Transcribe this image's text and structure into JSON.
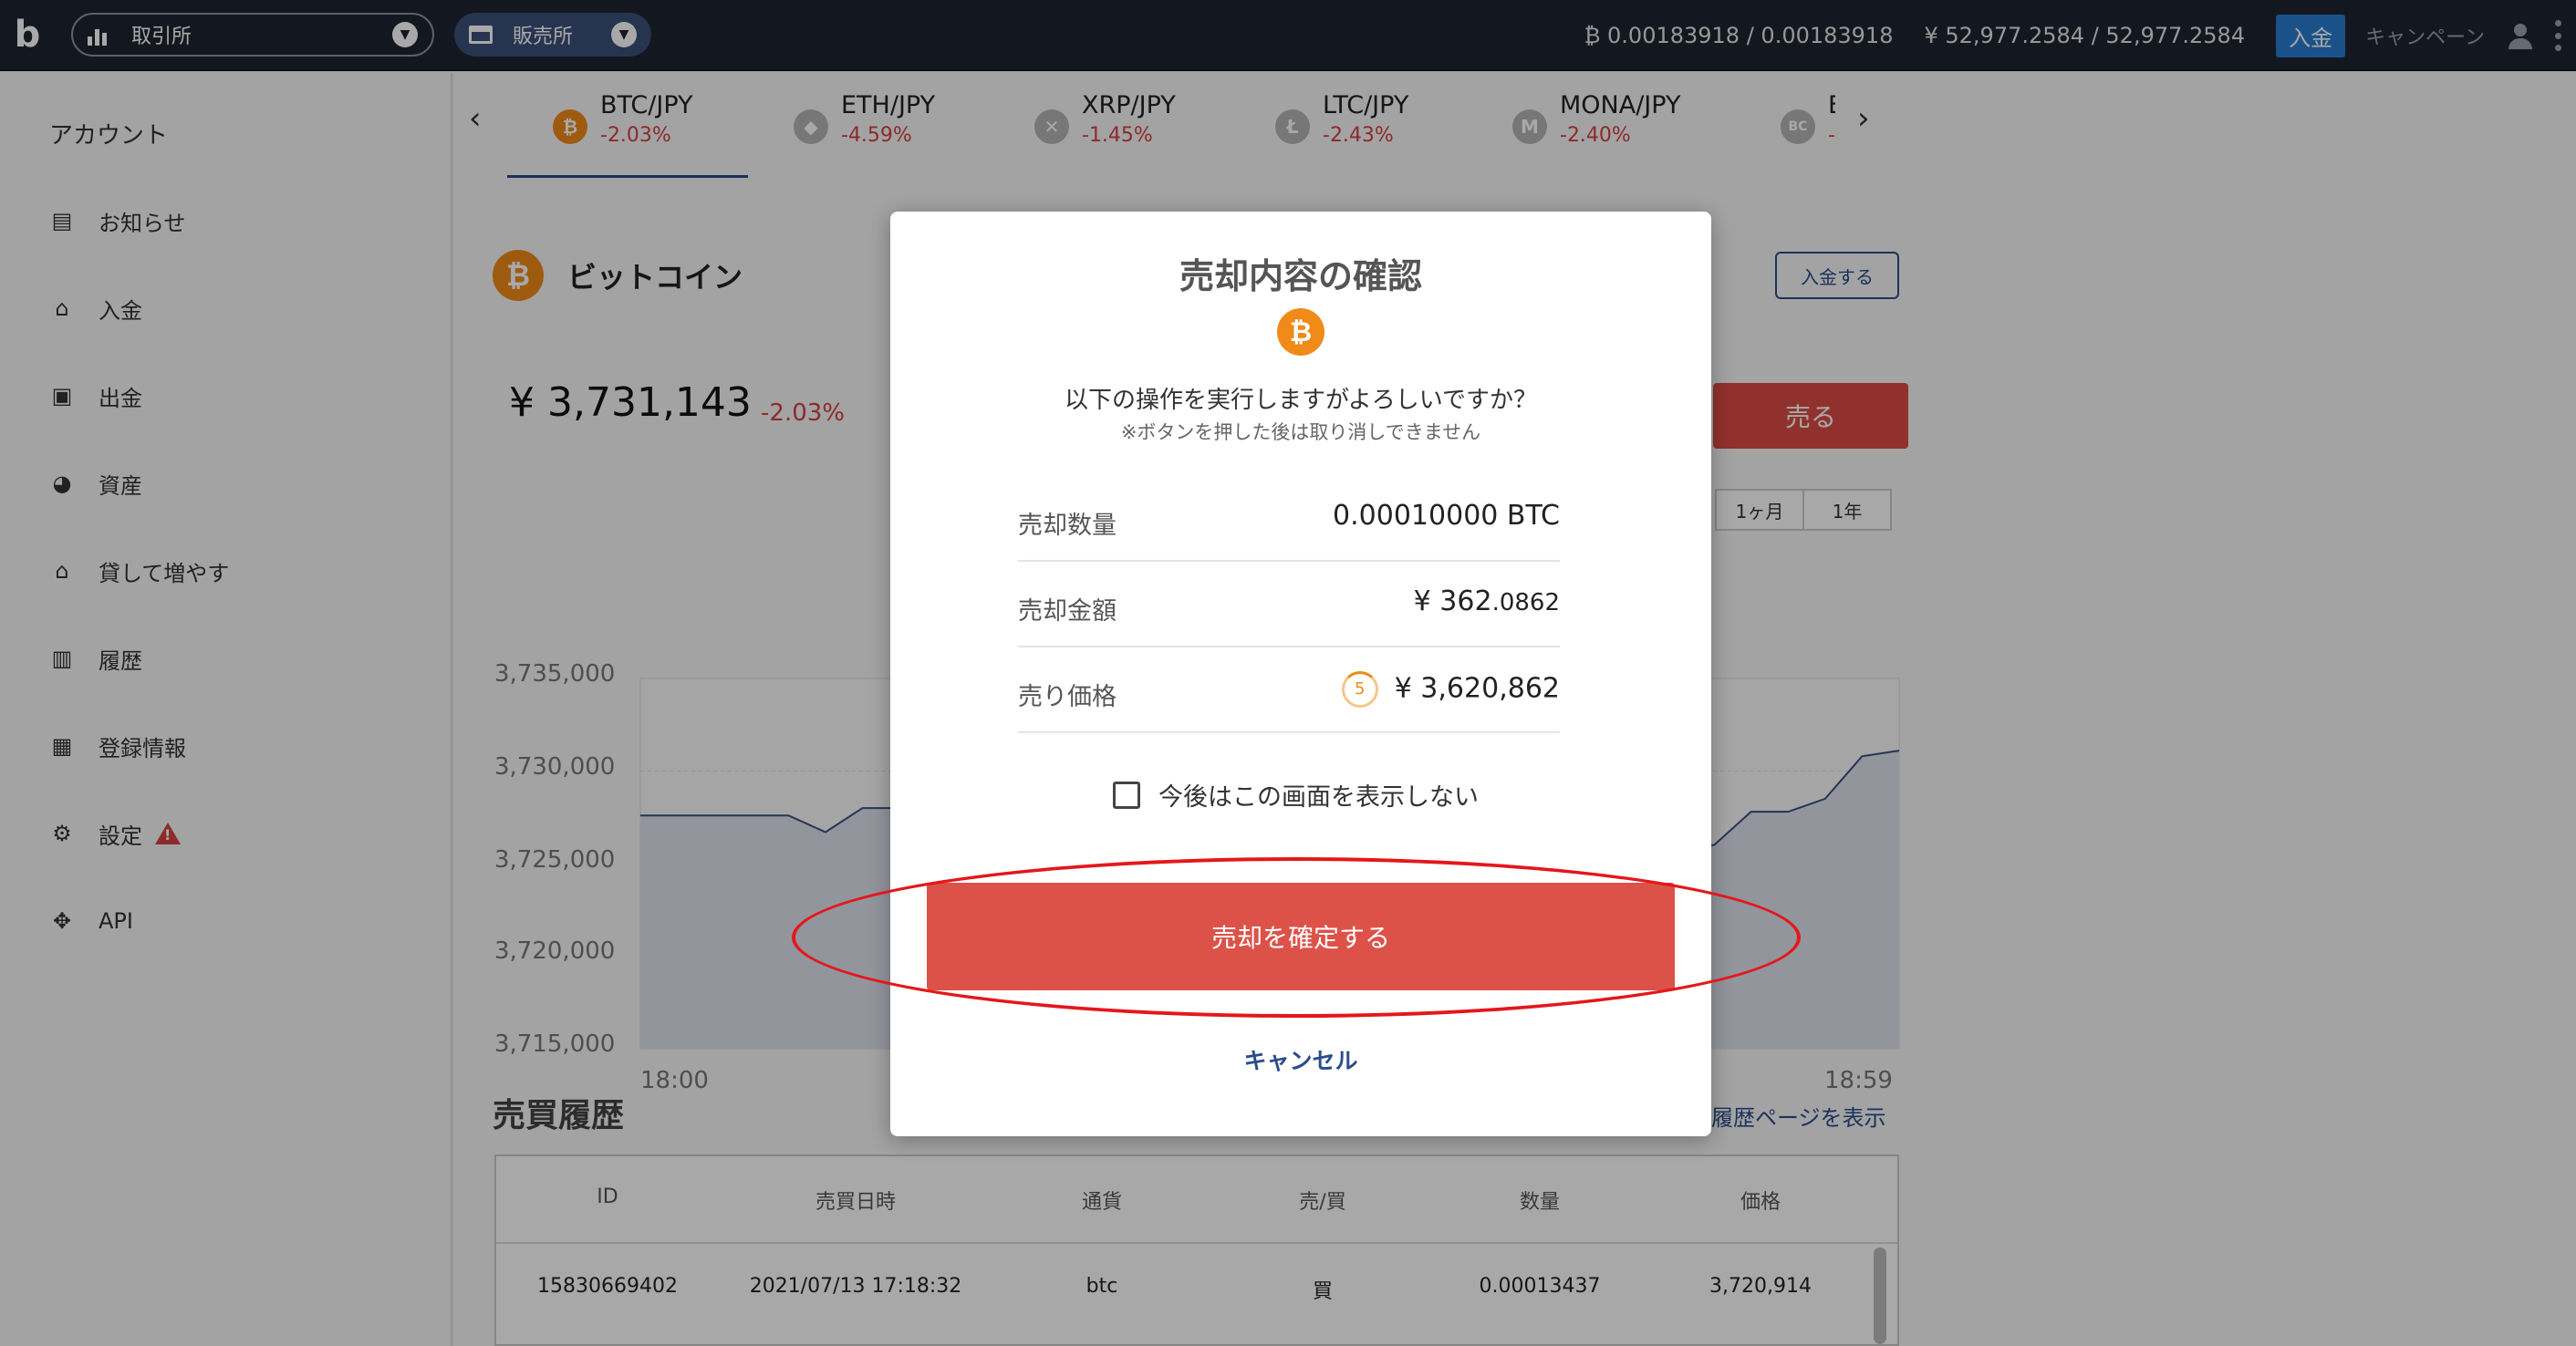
{
  "topbar": {
    "logo": "b",
    "exchange_label": "取引所",
    "shop_label": "販売所",
    "btc_balance": "₿ 0.00183918 / 0.00183918",
    "jpy_balance": "¥ 52,977.2584 / 52,977.2584",
    "deposit_label": "入金",
    "campaign_label": "キャンペーン"
  },
  "sidebar": {
    "title": "アカウント",
    "items": [
      {
        "label": "お知らせ",
        "icon": "message-icon"
      },
      {
        "label": "入金",
        "icon": "bank-icon"
      },
      {
        "label": "出金",
        "icon": "wallet-icon"
      },
      {
        "label": "資産",
        "icon": "pie-chart-icon"
      },
      {
        "label": "貸して増やす",
        "icon": "bank-icon"
      },
      {
        "label": "履歴",
        "icon": "clipboard-icon"
      },
      {
        "label": "登録情報",
        "icon": "id-badge-icon"
      },
      {
        "label": "設定",
        "icon": "gear-icon"
      },
      {
        "label": "API",
        "icon": "api-icon"
      }
    ]
  },
  "tabs": [
    {
      "pair": "BTC/JPY",
      "change": "-2.03%",
      "icon": "₿",
      "color": "#f08a18"
    },
    {
      "pair": "ETH/JPY",
      "change": "-4.59%",
      "icon": "◆",
      "color": "#b5b5b5"
    },
    {
      "pair": "XRP/JPY",
      "change": "-1.45%",
      "icon": "✕",
      "color": "#b5b5b5"
    },
    {
      "pair": "LTC/JPY",
      "change": "-2.43%",
      "icon": "Ł",
      "color": "#b5b5b5"
    },
    {
      "pair": "MONA/JPY",
      "change": "-2.40%",
      "icon": "M",
      "color": "#b5b5b5"
    },
    {
      "pair": "B",
      "change": "-2",
      "icon": "BC",
      "color": "#b5b5b5"
    }
  ],
  "coin": {
    "name": "ビットコイン",
    "price": "¥ 3,731,143",
    "change": "-2.03%",
    "deposit_label": "入金する",
    "sell_label": "売る",
    "ranges": [
      "1ヶ月",
      "1年"
    ]
  },
  "chart_data": {
    "type": "line",
    "y_ticks": [
      "3,735,000",
      "3,730,000",
      "3,725,000",
      "3,720,000",
      "3,715,000"
    ],
    "ylim": [
      3715000,
      3735000
    ],
    "x_ticks": [
      "18:00",
      "18:59"
    ],
    "x": [
      0,
      6,
      8,
      10,
      12,
      16,
      18,
      20,
      21,
      24,
      40,
      43,
      48,
      52,
      54,
      55,
      56,
      58,
      60,
      62,
      64,
      66,
      68
    ],
    "values": [
      3727600,
      3727600,
      3727600,
      3726700,
      3728000,
      3728000,
      3726500,
      3726500,
      3725000,
      3719500,
      3720500,
      3720700,
      3720800,
      3721000,
      3722800,
      3725000,
      3726000,
      3726000,
      3727800,
      3727800,
      3728500,
      3730800,
      3731100
    ],
    "grid": true
  },
  "history": {
    "title": "売買履歴",
    "link": "履歴ページを表示",
    "columns": [
      "ID",
      "売買日時",
      "通貨",
      "売/買",
      "数量",
      "価格"
    ],
    "rows": [
      [
        "15830669402",
        "2021/07/13 17:18:32",
        "btc",
        "買",
        "0.00013437",
        "3,720,914"
      ]
    ]
  },
  "modal": {
    "title": "売却内容の確認",
    "coin_icon": "₿",
    "question": "以下の操作を実行しますがよろしいですか？",
    "note": "※ボタンを押した後は取り消しできません",
    "rows": [
      {
        "label": "売却数量",
        "value_main": "0.00010000 BTC",
        "value_small": ""
      },
      {
        "label": "売却金額",
        "value_main": "¥ 362",
        "value_small": ".0862"
      },
      {
        "label": "売り価格",
        "value_main": "¥ 3,620,862",
        "value_small": ""
      }
    ],
    "timer": "5",
    "checkbox_label": "今後はこの画面を表示しない",
    "confirm_label": "売却を確定する",
    "cancel_label": "キャンセル"
  },
  "colors": {
    "topbar": "#1e2430",
    "accent_blue": "#2a4d8a",
    "sell_red": "#dc4b45",
    "btc_orange": "#f08a18",
    "highlight": "#e4171b"
  }
}
